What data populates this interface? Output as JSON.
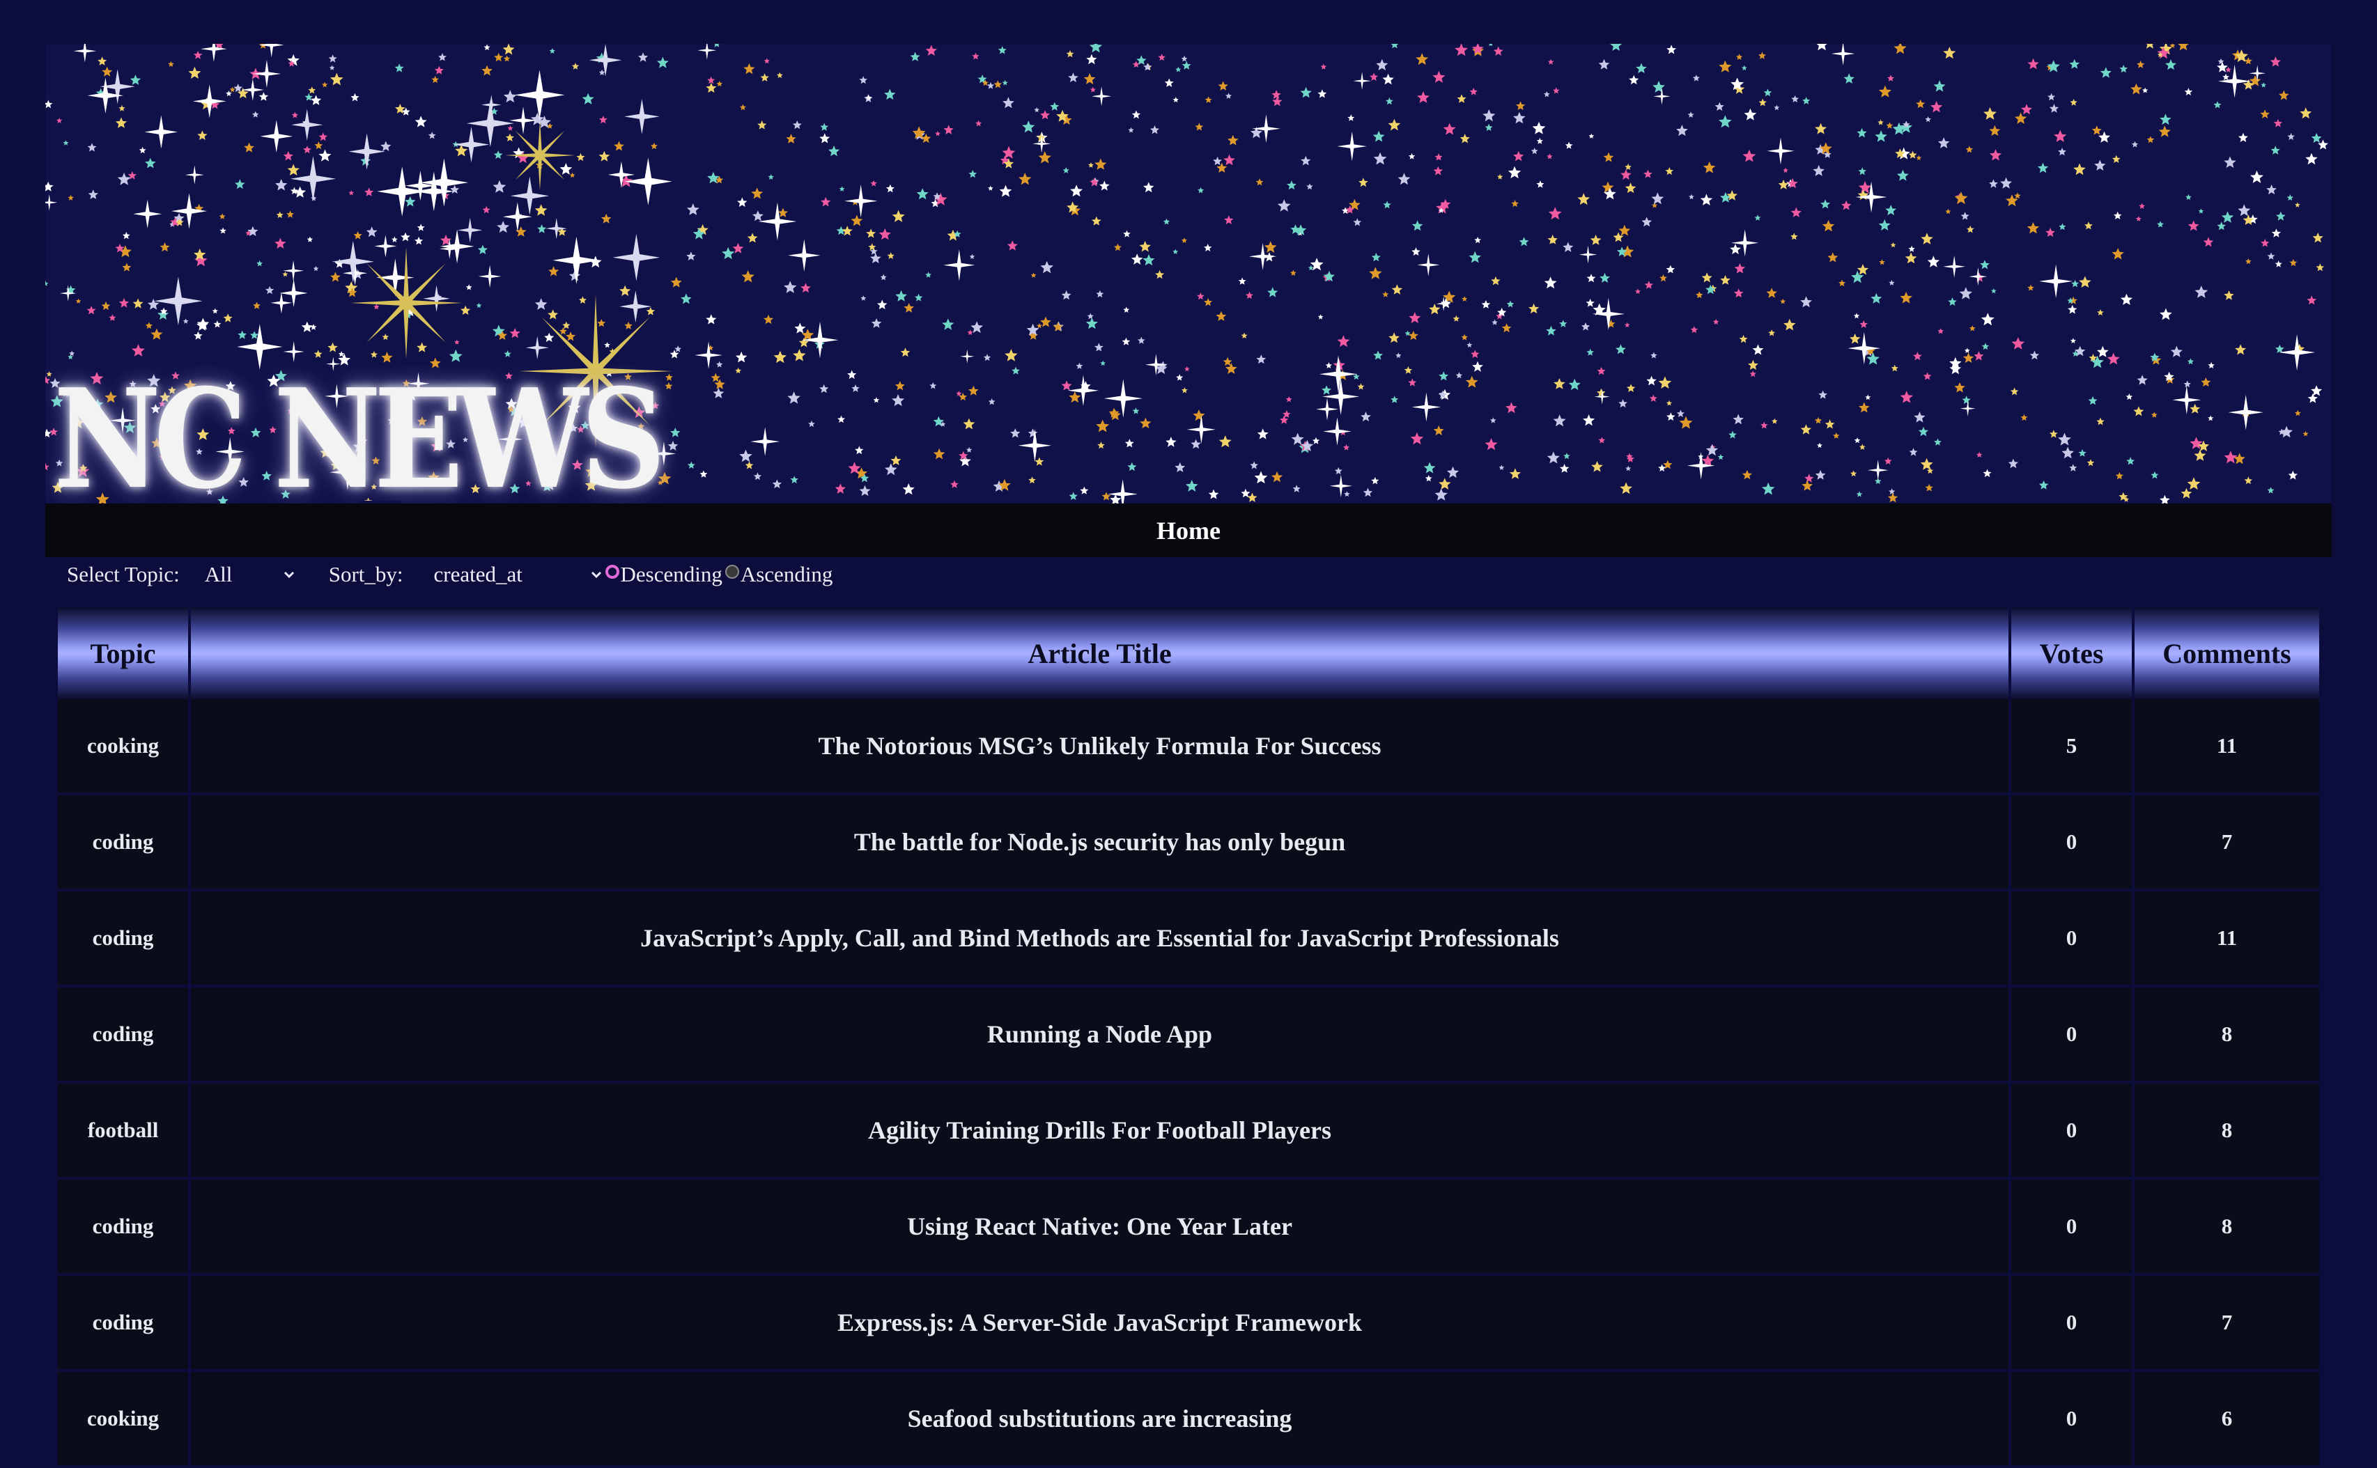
{
  "banner": {
    "logo_text": "NC NEWS",
    "logo_ornament": "⊶⊷"
  },
  "nav": {
    "home_label": "Home"
  },
  "controls": {
    "topic_label": "Select Topic:",
    "topic_value": "All",
    "sort_label": "Sort_by:",
    "sort_value": "created_at",
    "order_options": [
      {
        "label": "Descending",
        "checked": true
      },
      {
        "label": "Ascending",
        "checked": false
      }
    ]
  },
  "table": {
    "headers": {
      "topic": "Topic",
      "title": "Article Title",
      "votes": "Votes",
      "comments": "Comments"
    },
    "rows": [
      {
        "topic": "cooking",
        "title": "The Notorious MSG’s Unlikely Formula For Success",
        "votes": "5",
        "comments": "11"
      },
      {
        "topic": "coding",
        "title": "The battle for Node.js security has only begun",
        "votes": "0",
        "comments": "7"
      },
      {
        "topic": "coding",
        "title": "JavaScript’s Apply, Call, and Bind Methods are Essential for JavaScript Professionals",
        "votes": "0",
        "comments": "11"
      },
      {
        "topic": "coding",
        "title": "Running a Node App",
        "votes": "0",
        "comments": "8"
      },
      {
        "topic": "football",
        "title": "Agility Training Drills For Football Players",
        "votes": "0",
        "comments": "8"
      },
      {
        "topic": "coding",
        "title": "Using React Native: One Year Later",
        "votes": "0",
        "comments": "8"
      },
      {
        "topic": "coding",
        "title": "Express.js: A Server-Side JavaScript Framework",
        "votes": "0",
        "comments": "7"
      },
      {
        "topic": "cooking",
        "title": "Seafood substitutions are increasing",
        "votes": "0",
        "comments": "6"
      }
    ]
  },
  "colors": {
    "page_background": "#0d0d3d",
    "banner_background": "#11114a",
    "nav_background": "#07090f",
    "row_background": "#080d19",
    "header_highlight": "#aab2ff",
    "radio_checked": "#e06ad8",
    "star_colors": [
      "#ffffff",
      "#f05aa0",
      "#6fd6c8",
      "#e09a2a",
      "#f2d36a",
      "#c8c8e8"
    ]
  }
}
